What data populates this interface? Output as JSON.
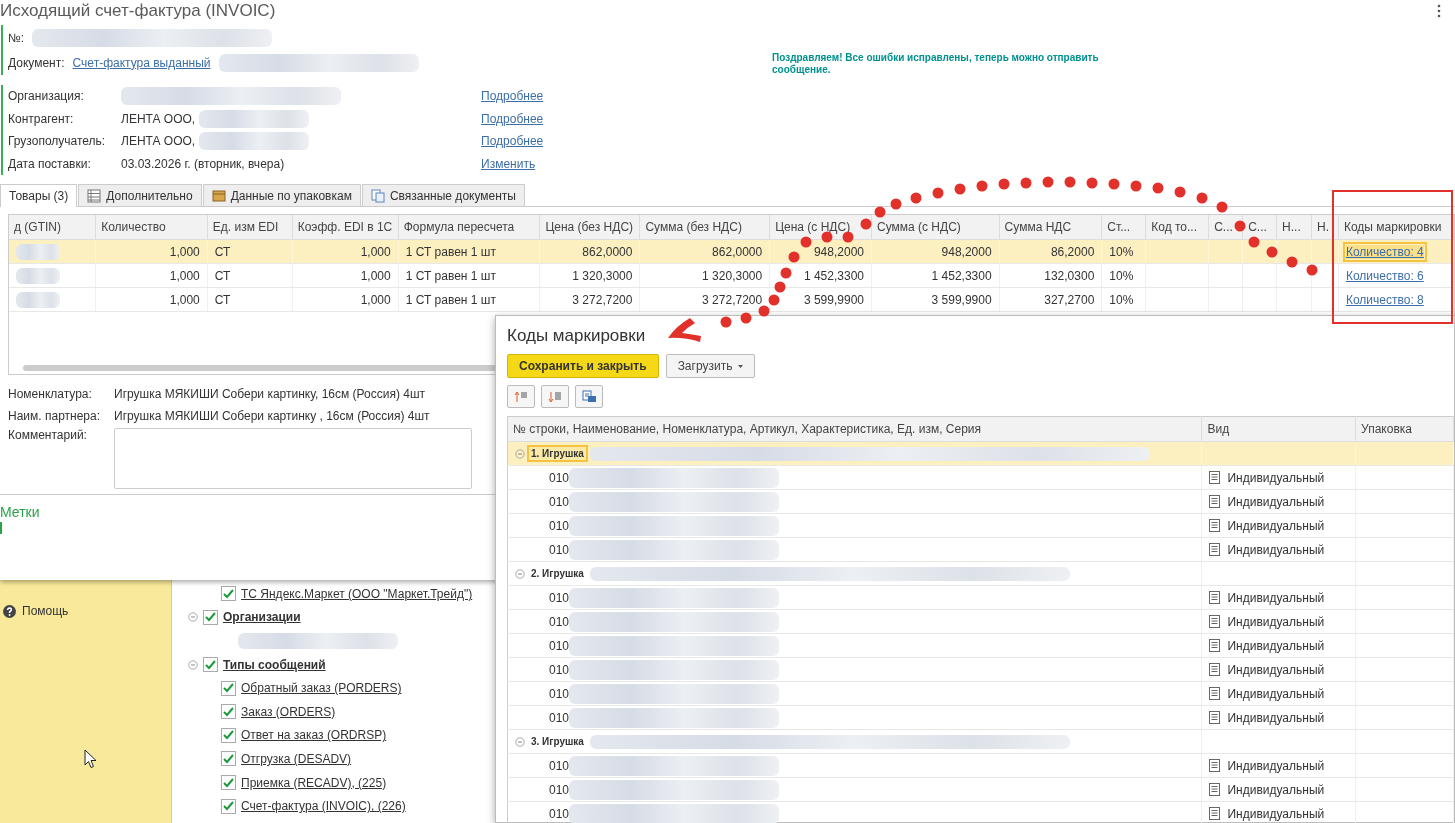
{
  "background_app": {
    "sidebar": {
      "items": [
        {
          "label": "Помощь"
        }
      ]
    },
    "tree": [
      {
        "label": "ТС Яндекс.Маркет (ООО \"Маркет.Трейд\")",
        "kind": "leaf",
        "checked": true
      },
      {
        "label": "Организации",
        "kind": "group",
        "checked": true,
        "expanded": true,
        "redacted_children": true
      },
      {
        "label": "Типы сообщений",
        "kind": "group",
        "checked": true,
        "expanded": true,
        "children": [
          {
            "label": "Обратный заказ (PORDERS)",
            "kind": "leaf",
            "checked": true
          },
          {
            "label": "Заказ (ORDERS)",
            "kind": "leaf",
            "checked": true
          },
          {
            "label": "Ответ на заказ (ORDRSP)",
            "kind": "leaf",
            "checked": true
          },
          {
            "label": "Отгрузка (DESADV)",
            "kind": "leaf",
            "checked": true
          },
          {
            "label": "Приемка (RECADV), (225)",
            "kind": "leaf",
            "checked": true
          },
          {
            "label": "Счет-фактура (INVOIC), (226)",
            "kind": "leaf",
            "checked": true
          }
        ]
      }
    ]
  },
  "invoice_window": {
    "title": "Исходящий счет-фактура (INVOIC)",
    "header_fields": [
      {
        "label": "№:",
        "redacted": true
      },
      {
        "label": "Документ:",
        "link": "Счет-фактура выданный",
        "redacted": true
      }
    ],
    "details": [
      {
        "label": "Организация:",
        "redacted": true,
        "link": "Подробнее"
      },
      {
        "label": "Контрагент:",
        "value": "ЛЕНТА ООО,",
        "redacted": true,
        "link": "Подробнее"
      },
      {
        "label": "Грузополучатель:",
        "value": "ЛЕНТА ООО,",
        "redacted": true,
        "link": "Подробнее"
      },
      {
        "label": "Дата поставки:",
        "value": "03.03.2026 г. (вторник, вчера)",
        "redacted": false,
        "link": "Изменить"
      }
    ],
    "notice": "Поздравляем! Все ошибки исправлены, теперь можно отправить сообщение.",
    "tabs": [
      {
        "label": "Товары (3)",
        "selected": true
      },
      {
        "label": "Дополнительно",
        "selected": false
      },
      {
        "label": "Данные по упаковкам",
        "selected": false
      },
      {
        "label": "Связанные документы",
        "selected": false
      }
    ],
    "table": {
      "columns": [
        {
          "label": "д (GTIN)",
          "kind": "redacted"
        },
        {
          "label": "Количество",
          "kind": "number"
        },
        {
          "label": "Ед. изм EDI",
          "kind": "text"
        },
        {
          "label": "Коэфф. EDI в 1С",
          "kind": "number"
        },
        {
          "label": "Формула пересчета",
          "kind": "text"
        },
        {
          "label": "Цена (без НДС)",
          "kind": "number"
        },
        {
          "label": "Сумма (без НДС)",
          "kind": "number"
        },
        {
          "label": "Цена (с НДС)",
          "kind": "number"
        },
        {
          "label": "Сумма (с НДС)",
          "kind": "number"
        },
        {
          "label": "Сумма НДС",
          "kind": "number"
        },
        {
          "label": "Ст...",
          "kind": "text"
        },
        {
          "label": "Код то...",
          "kind": "text"
        },
        {
          "label": "С...",
          "kind": "text"
        },
        {
          "label": "С...",
          "kind": "text"
        },
        {
          "label": "Н...",
          "kind": "text"
        },
        {
          "label": "Н.",
          "kind": "text"
        },
        {
          "label": "Коды маркировки",
          "kind": "link"
        }
      ],
      "rows": [
        {
          "selected": true,
          "cells": [
            null,
            "1,000",
            "СТ",
            "1,000",
            "1 СТ равен 1 шт",
            "862,0000",
            "862,0000",
            "948,2000",
            "948,2000",
            "86,2000",
            "10%",
            null,
            null,
            null,
            null,
            null,
            "Количество: 4"
          ]
        },
        {
          "selected": false,
          "cells": [
            null,
            "1,000",
            "СТ",
            "1,000",
            "1 СТ равен 1 шт",
            "1 320,3000",
            "1 320,3000",
            "1 452,3300",
            "1 452,3300",
            "132,0300",
            "10%",
            null,
            null,
            null,
            null,
            null,
            "Количество: 6"
          ]
        },
        {
          "selected": false,
          "cells": [
            null,
            "1,000",
            "СТ",
            "1,000",
            "1 СТ равен 1 шт",
            "3 272,7200",
            "3 272,7200",
            "3 599,9900",
            "3 599,9900",
            "327,2700",
            "10%",
            null,
            null,
            null,
            null,
            null,
            "Количество: 8"
          ]
        }
      ]
    },
    "item_info": [
      {
        "label": "Номенклатура:",
        "value": "Игрушка МЯКИШИ Собери картинку, 16см (Россия) 4шт"
      },
      {
        "label": "Наим. партнера:",
        "value": "Игрушка МЯКИШИ Собери картинку , 16см (Россия) 4шт"
      }
    ],
    "comment": {
      "label": "Комментарий:"
    },
    "tags": {
      "title": "Метки"
    }
  },
  "marking_dialog": {
    "title": "Коды маркировки",
    "buttons": [
      {
        "label": "Сохранить и закрыть",
        "kind": "primary"
      },
      {
        "label": "Загрузить",
        "kind": "dropdown"
      }
    ],
    "columns": [
      "№ строки, Наименование, Номенклатура, Артикул, Характеристика, Ед. изм, Серия",
      "Вид",
      "Упаковка"
    ],
    "groups": [
      {
        "label": "1. Игрушка",
        "selected": true,
        "expanded": true,
        "items": [
          {
            "code": "010",
            "type": "Индивидуальный"
          },
          {
            "code": "010",
            "type": "Индивидуальный"
          },
          {
            "code": "010",
            "type": "Индивидуальный"
          },
          {
            "code": "010",
            "type": "Индивидуальный"
          }
        ]
      },
      {
        "label": "2. Игрушка",
        "selected": false,
        "expanded": true,
        "items": [
          {
            "code": "010",
            "type": "Индивидуальный"
          },
          {
            "code": "010",
            "type": "Индивидуальный"
          },
          {
            "code": "010",
            "type": "Индивидуальный"
          },
          {
            "code": "010",
            "type": "Индивидуальный"
          },
          {
            "code": "010",
            "type": "Индивидуальный"
          },
          {
            "code": "010",
            "type": "Индивидуальный"
          }
        ]
      },
      {
        "label": "3. Игрушка",
        "selected": false,
        "expanded": true,
        "items": [
          {
            "code": "010",
            "type": "Индивидуальный"
          },
          {
            "code": "010",
            "type": "Индивидуальный"
          },
          {
            "code": "010",
            "type": "Индивидуальный"
          }
        ]
      }
    ]
  }
}
